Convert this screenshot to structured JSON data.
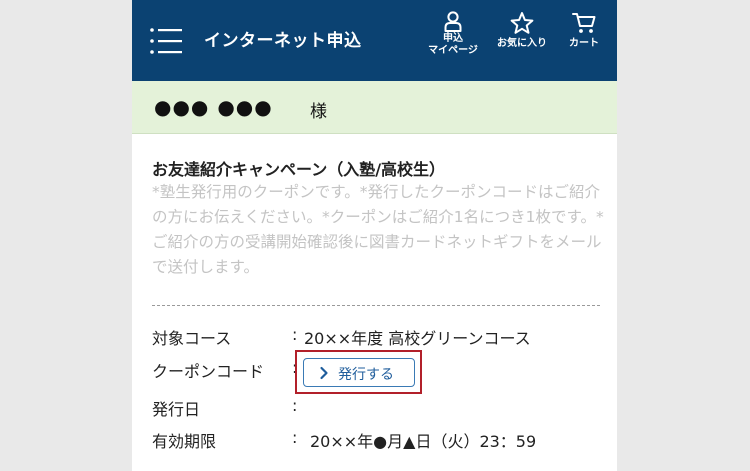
{
  "header": {
    "title": "インターネット申込",
    "mypage_line1": "申込",
    "mypage_line2": "マイページ",
    "favorites_label": "お気に入り",
    "cart_label": "カート"
  },
  "user": {
    "masked_name": "●●● ●●●",
    "suffix": "様"
  },
  "campaign": {
    "title": "お友達紹介キャンペーン（入塾/高校生）",
    "description": "*塾生発行用のクーポンです。*発行したクーポンコードはご紹介の方にお伝えください。*クーポンはご紹介1名につき1枚です。*ご紹介の方の受講開始確認後に図書カードネットギフトをメールで送付します。"
  },
  "details": {
    "course_label": "対象コース",
    "course_value": "20××年度 高校グリーンコース",
    "coupon_label": "クーポンコード",
    "issue_button": "発行する",
    "issue_date_label": "発行日",
    "issue_date_value": "",
    "expiry_label": "有効期限",
    "expiry_value": "20××年●月▲日（火）23：59",
    "colon": ":"
  },
  "icons": {
    "menu": "hamburger-menu-icon",
    "mypage": "person-icon",
    "favorites": "star-icon",
    "cart": "cart-icon",
    "issue_button": "chevron-right-icon"
  },
  "colors": {
    "header_bg": "#0b4272",
    "name_bar_bg": "#e4f2d9",
    "button_border": "#3a7ab5",
    "highlight_frame": "#b2202a",
    "muted_text": "#c4c4c4"
  }
}
